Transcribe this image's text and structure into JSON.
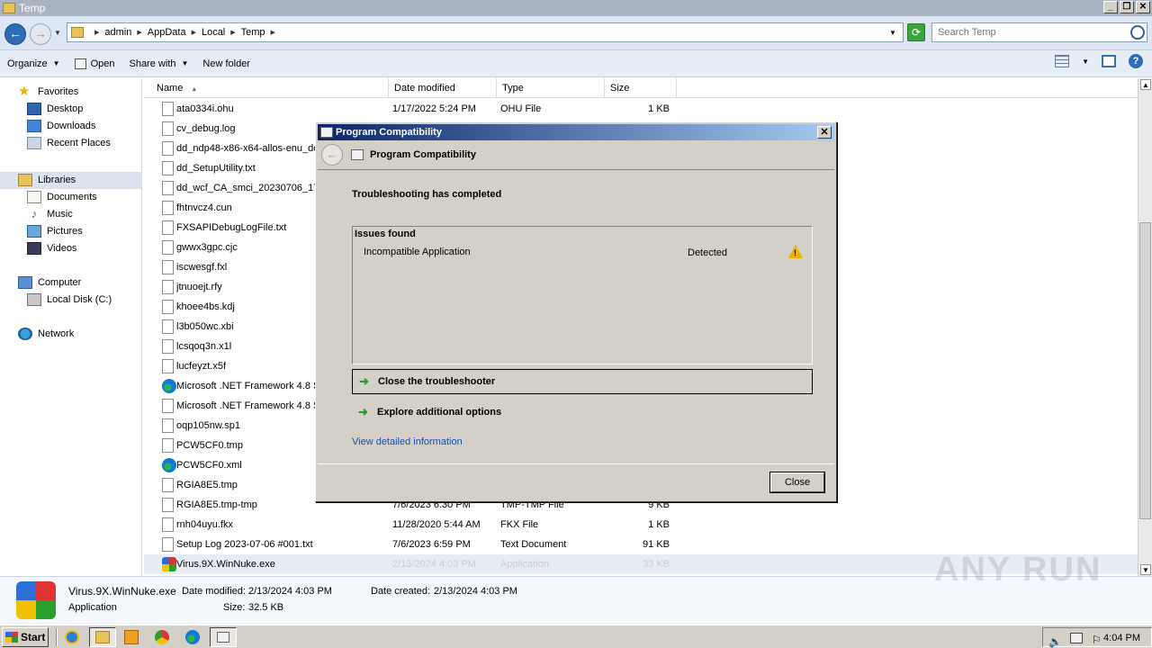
{
  "window": {
    "title": "Temp"
  },
  "address": {
    "crumbs": [
      "admin",
      "AppData",
      "Local",
      "Temp"
    ],
    "search_placeholder": "Search Temp"
  },
  "toolbar": {
    "organize": "Organize",
    "open": "Open",
    "share_with": "Share with",
    "new_folder": "New folder"
  },
  "nav": {
    "favorites": "Favorites",
    "desktop": "Desktop",
    "downloads": "Downloads",
    "recent_places": "Recent Places",
    "libraries": "Libraries",
    "documents": "Documents",
    "music": "Music",
    "pictures": "Pictures",
    "videos": "Videos",
    "computer": "Computer",
    "local_disk": "Local Disk (C:)",
    "network": "Network"
  },
  "columns": {
    "name": "Name",
    "date": "Date modified",
    "type": "Type",
    "size": "Size"
  },
  "files": [
    {
      "name": "ata0334i.ohu",
      "date": "1/17/2022 5:24 PM",
      "type": "OHU File",
      "size": "1 KB",
      "icon": "file"
    },
    {
      "name": "cv_debug.log",
      "date": "",
      "type": "",
      "size": "",
      "icon": "file"
    },
    {
      "name": "dd_ndp48-x86-x64-allos-enu_de",
      "date": "",
      "type": "",
      "size": "",
      "icon": "file"
    },
    {
      "name": "dd_SetupUtility.txt",
      "date": "",
      "type": "",
      "size": "",
      "icon": "file"
    },
    {
      "name": "dd_wcf_CA_smci_20230706_17",
      "date": "",
      "type": "",
      "size": "",
      "icon": "file"
    },
    {
      "name": "fhtnvcz4.cun",
      "date": "",
      "type": "",
      "size": "",
      "icon": "file"
    },
    {
      "name": "FXSAPIDebugLogFile.txt",
      "date": "",
      "type": "",
      "size": "",
      "icon": "file"
    },
    {
      "name": "gwwx3gpc.cjc",
      "date": "",
      "type": "",
      "size": "",
      "icon": "file"
    },
    {
      "name": "iscwesgf.fxl",
      "date": "",
      "type": "",
      "size": "",
      "icon": "file"
    },
    {
      "name": "jtnuoejt.rfy",
      "date": "",
      "type": "",
      "size": "",
      "icon": "file"
    },
    {
      "name": "khoee4bs.kdj",
      "date": "",
      "type": "",
      "size": "",
      "icon": "file"
    },
    {
      "name": "l3b050wc.xbi",
      "date": "",
      "type": "",
      "size": "",
      "icon": "file"
    },
    {
      "name": "lcsqoq3n.x1l",
      "date": "",
      "type": "",
      "size": "",
      "icon": "file"
    },
    {
      "name": "lucfeyzt.x5f",
      "date": "",
      "type": "",
      "size": "",
      "icon": "file"
    },
    {
      "name": "Microsoft .NET Framework 4.8 S",
      "date": "",
      "type": "",
      "size": "",
      "icon": "edge"
    },
    {
      "name": "Microsoft .NET Framework 4.8 S",
      "date": "",
      "type": "",
      "size": "",
      "icon": "file"
    },
    {
      "name": "oqp105nw.sp1",
      "date": "",
      "type": "",
      "size": "",
      "icon": "file"
    },
    {
      "name": "PCW5CF0.tmp",
      "date": "",
      "type": "",
      "size": "",
      "icon": "file"
    },
    {
      "name": "PCW5CF0.xml",
      "date": "",
      "type": "",
      "size": "",
      "icon": "edge"
    },
    {
      "name": "RGIA8E5.tmp",
      "date": "",
      "type": "",
      "size": "",
      "icon": "file"
    },
    {
      "name": "RGIA8E5.tmp-tmp",
      "date": "7/6/2023 6:30 PM",
      "type": "TMP-TMP File",
      "size": "9 KB",
      "icon": "file"
    },
    {
      "name": "rnh04uyu.fkx",
      "date": "11/28/2020 5:44 AM",
      "type": "FKX File",
      "size": "1 KB",
      "icon": "file"
    },
    {
      "name": "Setup Log 2023-07-06 #001.txt",
      "date": "7/6/2023 6:59 PM",
      "type": "Text Document",
      "size": "91 KB",
      "icon": "file"
    },
    {
      "name": "Virus.9X.WinNuke.exe",
      "date": "2/13/2024 4:03 PM",
      "type": "Application",
      "size": "33 KB",
      "icon": "exe",
      "selected": true
    }
  ],
  "details": {
    "filename": "Virus.9X.WinNuke.exe",
    "date_modified_label": "Date modified:",
    "date_modified": "2/13/2024 4:03 PM",
    "date_created_label": "Date created:",
    "date_created": "2/13/2024 4:03 PM",
    "type": "Application",
    "size_label": "Size:",
    "size": "32.5 KB"
  },
  "dialog": {
    "title": "Program Compatibility",
    "header": "Program Compatibility",
    "heading": "Troubleshooting has completed",
    "issues_title": "Issues found",
    "issue_name": "Incompatible Application",
    "issue_status": "Detected",
    "action_close": "Close the troubleshooter",
    "action_explore": "Explore additional options",
    "detail_link": "View detailed information",
    "close_button": "Close"
  },
  "taskbar": {
    "start": "Start",
    "clock": "4:04 PM"
  },
  "watermark": "ANY RUN"
}
